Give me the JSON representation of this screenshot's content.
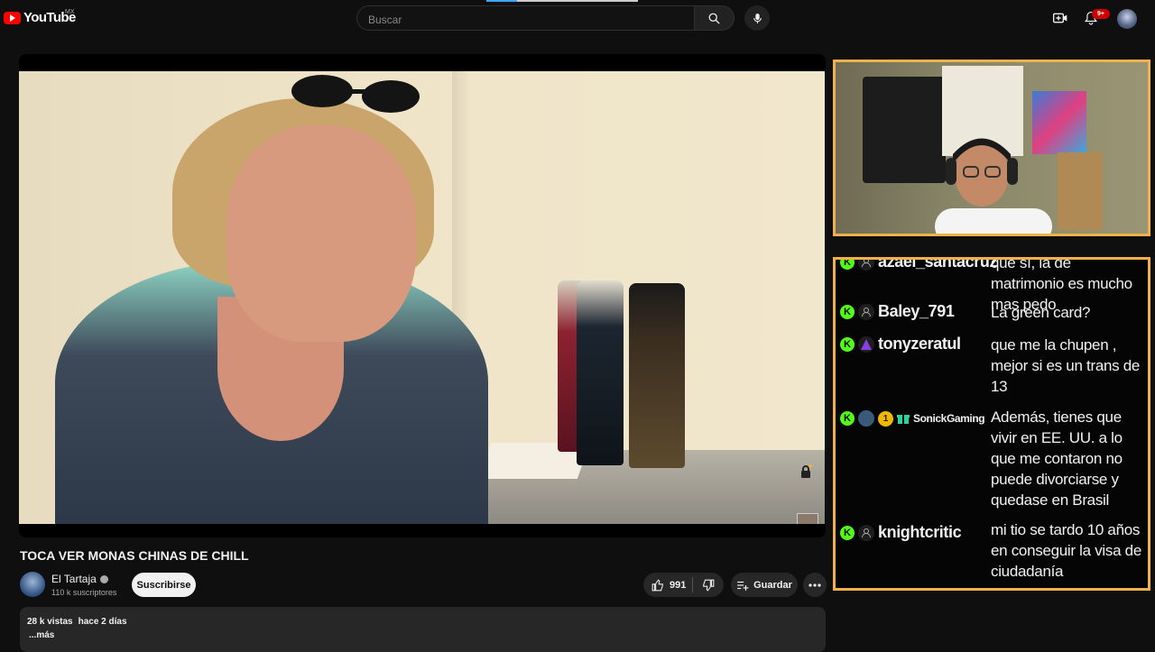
{
  "header": {
    "logo_text": "YouTube",
    "region": "MX",
    "search_placeholder": "Buscar",
    "notification_count": "9+"
  },
  "video": {
    "title": "TOCA VER MONAS CHINAS DE CHILL",
    "channel": "El Tartaja",
    "subscribers": "110 k suscriptores",
    "subscribe_label": "Suscribirse",
    "likes": "991",
    "save_label": "Guardar",
    "views": "28 k vistas",
    "published": "hace 2 días",
    "more": "...más"
  },
  "chat": {
    "messages": [
      {
        "user": "azael_santacruz",
        "text": "que sí, la de matrimonio es mucho mas pedo"
      },
      {
        "user": "Baley_791",
        "text": "La green card?"
      },
      {
        "user": "tonyzeratul",
        "text": "que me la chupen , mejor si es un trans de 13"
      },
      {
        "user": "SonickGaming",
        "badge": "1",
        "text": "Además, tienes que vivir en EE. UU. a lo que me contaron no puede divorciarse y quedase en Brasil"
      },
      {
        "user": "knightcritic",
        "text": "mi tio se tardo 10 años en conseguir la visa de ciudadanía"
      }
    ]
  },
  "icons": {
    "kick": "K",
    "colors": {
      "accent_border": "#f0b04a",
      "kick_green": "#53fc18",
      "yt_red": "#ff0000"
    }
  }
}
